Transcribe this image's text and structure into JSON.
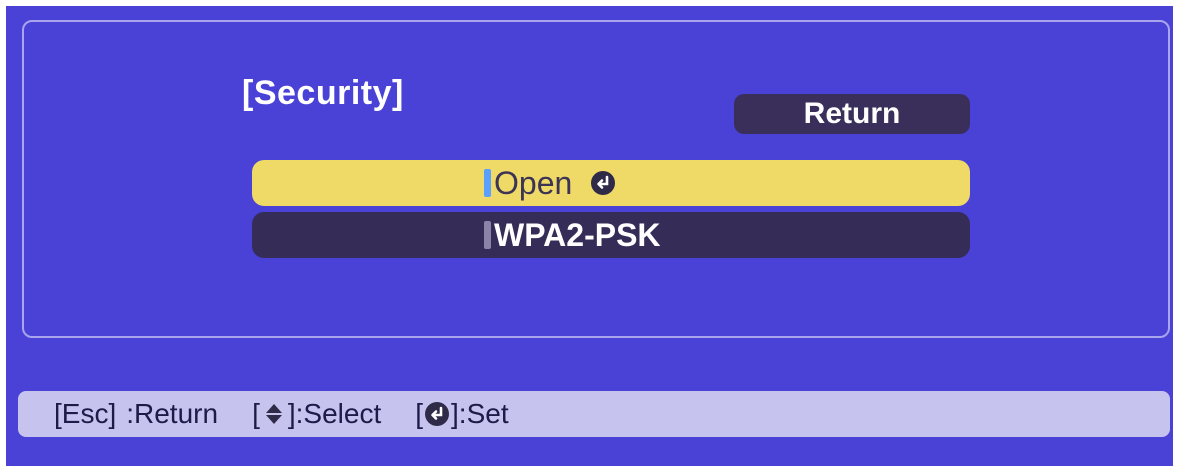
{
  "dialog": {
    "title": "[Security]",
    "return_label": "Return"
  },
  "options": [
    {
      "label": "Open",
      "selected": true,
      "icon": "enter-icon"
    },
    {
      "label": "WPA2-PSK",
      "selected": false
    }
  ],
  "footer": {
    "esc_label": "[Esc]",
    "esc_action": ":Return",
    "select_open": "[",
    "select_icon": "up-down-arrow-icon",
    "select_action": "]:Select",
    "set_open": "[",
    "set_icon": "enter-icon",
    "set_action": "]:Set"
  },
  "colors": {
    "background": "#4a42d6",
    "selected_option": "#efd967",
    "unselected_option": "#352d57",
    "footer_bar": "#c6c4ee"
  }
}
